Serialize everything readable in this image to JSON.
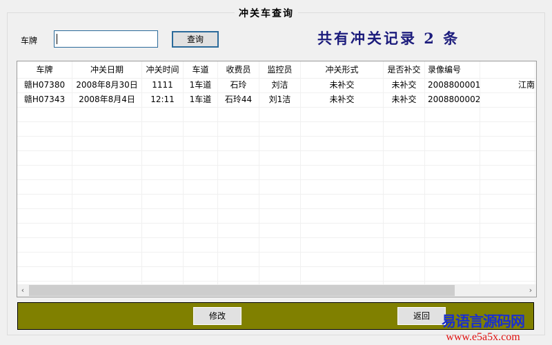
{
  "window": {
    "title": "冲关车查询"
  },
  "search": {
    "label": "车牌",
    "value": "",
    "button": "查询"
  },
  "summary": "共有冲关记录 2 条",
  "table": {
    "columns": [
      "车牌",
      "冲关日期",
      "冲关时间",
      "车道",
      "收费员",
      "监控员",
      "冲关形式",
      "是否补交",
      "录像编号",
      ""
    ],
    "rows": [
      [
        "赣H07380",
        "2008年8月30日",
        "1111",
        "1车道",
        "石玲",
        "刘洁",
        "未补交",
        "未补交",
        "2008800001",
        "江南"
      ],
      [
        "赣H07343",
        "2008年8月4日",
        "12:11",
        "1车道",
        "石玲44",
        "刘1洁",
        "未补交",
        "未补交",
        "2008800002",
        ""
      ]
    ]
  },
  "buttons": {
    "modify": "修改",
    "back": "返回"
  },
  "watermark": {
    "line1": "易语言源码网",
    "line2": "www.e5a5x.com"
  },
  "colors": {
    "panel": "#808000",
    "summary": "#1c1c7c"
  }
}
